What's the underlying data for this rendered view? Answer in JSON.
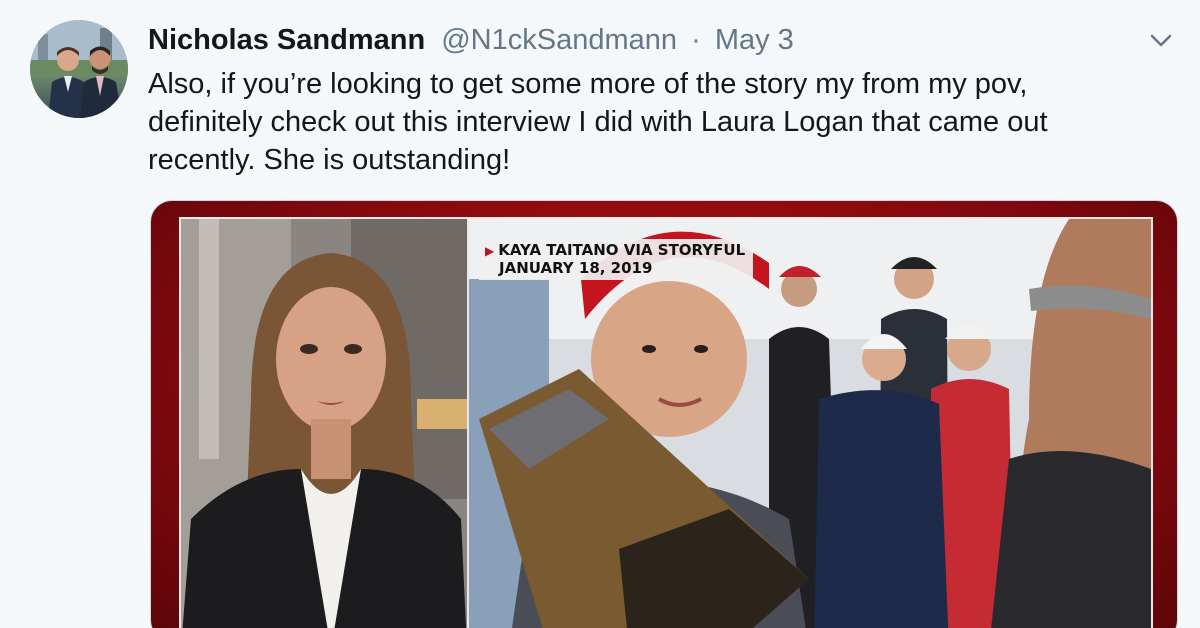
{
  "tweet": {
    "author_name": "Nicholas Sandmann",
    "handle": "@N1ckSandmann",
    "separator": "·",
    "date": "May 3",
    "text_lines": [
      "Also, if you’re looking to get some more of the story my from my pov,",
      "definitely check out this interview I did with Laura Logan that came out",
      "recently. She is outstanding!"
    ]
  },
  "media": {
    "caption_source": "KAYA TAITANO VIA STORYFUL",
    "caption_date": "JANUARY 18, 2019"
  },
  "icons": {
    "avatar": "profile-photo",
    "caret": "chevron-down-icon",
    "caption_marker": "triangle-right-icon"
  },
  "colors": {
    "background": "#f5f8fa",
    "name": "#14171a",
    "meta": "#657786",
    "frame_red": "#c2121b"
  }
}
